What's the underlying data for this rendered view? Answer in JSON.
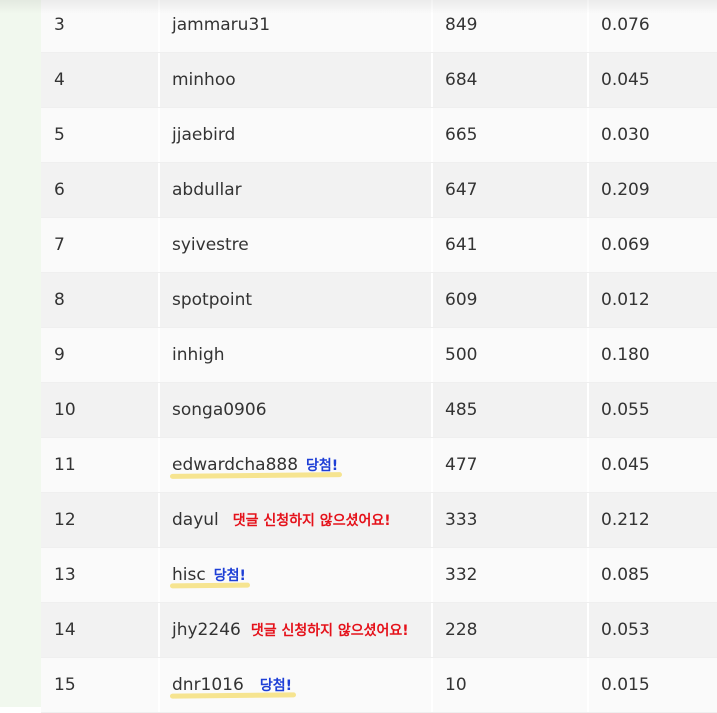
{
  "rows": [
    {
      "rank": "3",
      "name": "jammaru31",
      "count": "849",
      "ratio": "0.076",
      "note": "",
      "note_type": ""
    },
    {
      "rank": "4",
      "name": "minhoo",
      "count": "684",
      "ratio": "0.045",
      "note": "",
      "note_type": ""
    },
    {
      "rank": "5",
      "name": "jjaebird",
      "count": "665",
      "ratio": "0.030",
      "note": "",
      "note_type": ""
    },
    {
      "rank": "6",
      "name": "abdullar",
      "count": "647",
      "ratio": "0.209",
      "note": "",
      "note_type": ""
    },
    {
      "rank": "7",
      "name": "syivestre",
      "count": "641",
      "ratio": "0.069",
      "note": "",
      "note_type": ""
    },
    {
      "rank": "8",
      "name": "spotpoint",
      "count": "609",
      "ratio": "0.012",
      "note": "",
      "note_type": ""
    },
    {
      "rank": "9",
      "name": "inhigh",
      "count": "500",
      "ratio": "0.180",
      "note": "",
      "note_type": ""
    },
    {
      "rank": "10",
      "name": "songa0906",
      "count": "485",
      "ratio": "0.055",
      "note": "",
      "note_type": ""
    },
    {
      "rank": "11",
      "name": "edwardcha888",
      "count": "477",
      "ratio": "0.045",
      "note": "당첨!",
      "note_type": "win"
    },
    {
      "rank": "12",
      "name": "dayul",
      "count": "333",
      "ratio": "0.212",
      "note": "댓글 신청하지 않으셨어요!",
      "note_type": "nocomment"
    },
    {
      "rank": "13",
      "name": "hisc",
      "count": "332",
      "ratio": "0.085",
      "note": "당첨!",
      "note_type": "win"
    },
    {
      "rank": "14",
      "name": "jhy2246",
      "count": "228",
      "ratio": "0.053",
      "note": "댓글 신청하지 않으셨어요!",
      "note_type": "nocomment"
    },
    {
      "rank": "15",
      "name": "dnr1016",
      "count": "10",
      "ratio": "0.015",
      "note": "당첨!",
      "note_type": "win"
    }
  ],
  "colors": {
    "win": "#1e3fd6",
    "nocomment": "#e5121b",
    "highlight": "#f4df7c",
    "sidebar": "#f1f8ee"
  }
}
